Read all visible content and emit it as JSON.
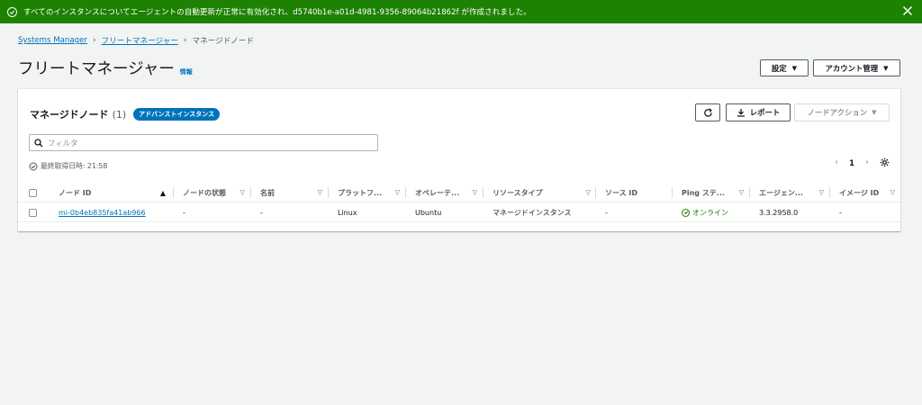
{
  "banner": {
    "message": "すべてのインスタンスについてエージェントの自動更新が正常に有効化され、d5740b1e-a01d-4981-9356-89064b21862f が作成されました。",
    "color": "#1d8102"
  },
  "breadcrumb": {
    "items": [
      "Systems Manager",
      "フリートマネージャー",
      "マネージドノード"
    ]
  },
  "header": {
    "title": "フリートマネージャー",
    "info": "情報",
    "settings_label": "設定",
    "account_label": "アカウント管理"
  },
  "card": {
    "title": "マネージドノード",
    "count": "(1)",
    "badge": "アドバンストインスタンス",
    "report_label": "レポート",
    "node_action_label": "ノードアクション",
    "filter_placeholder": "フィルタ",
    "last_fetched": "最終取得日時: 21:58",
    "page": "1"
  },
  "table": {
    "columns": [
      "ノード ID",
      "ノードの状態",
      "名前",
      "プラットフ...",
      "オペレーテ...",
      "リソースタイプ",
      "ソース ID",
      "Ping ステ...",
      "エージェン...",
      "イメージ ID"
    ],
    "row": {
      "node_id": "mi-0b4eb835fa41ab966",
      "state": "-",
      "name": "-",
      "platform": "Linux",
      "os": "Ubuntu",
      "resource_type": "マネージドインスタンス",
      "source_id": "-",
      "ping": "オンライン",
      "agent": "3.3.2958.0",
      "image_id": "-"
    }
  },
  "colors": {
    "link": "#0073bb",
    "success": "#1d8102",
    "badge": "#0073bb"
  }
}
